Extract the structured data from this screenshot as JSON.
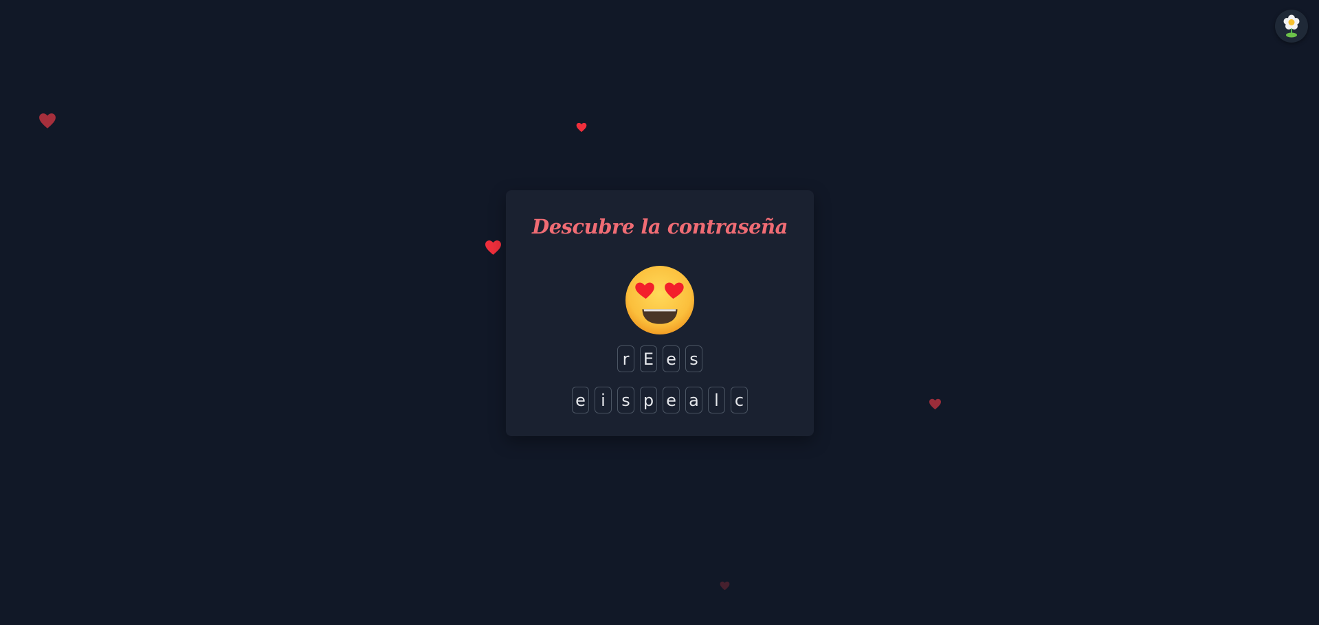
{
  "title": "Descubre la contraseña",
  "emoji": {
    "icon": "heart-eyes-face-icon"
  },
  "answer_tiles": [
    "r",
    "E",
    "e",
    "s"
  ],
  "letter_tiles": [
    "e",
    "i",
    "s",
    "p",
    "e",
    "a",
    "l",
    "c"
  ],
  "corner_button": {
    "icon": "flower-icon"
  },
  "colors": {
    "background": "#111827",
    "card": "#1a2130",
    "title": "#f06c74",
    "tile_border": "#4b5563",
    "tile_text": "#e5e7eb",
    "heart": "#e53945"
  }
}
